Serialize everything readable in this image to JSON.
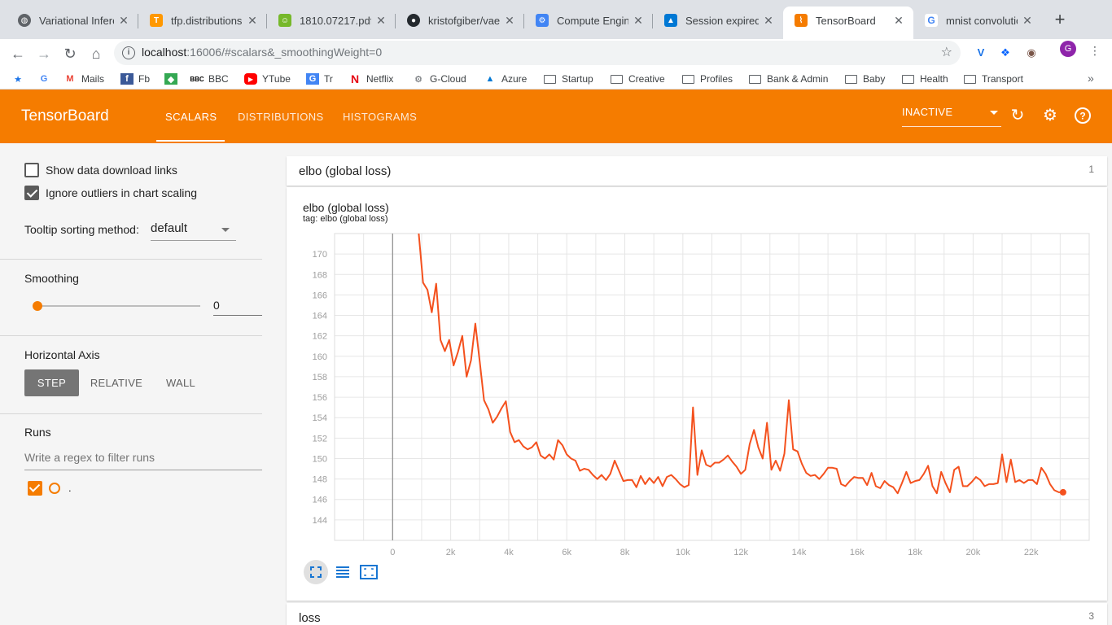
{
  "browser": {
    "tabs": [
      {
        "label": "Variational Infere",
        "icon_color": "#5f6368",
        "icon": "globe-icon"
      },
      {
        "label": "tfp.distributions.",
        "icon_color": "#ff9800",
        "icon": "tensorflow-icon"
      },
      {
        "label": "1810.07217.pdf",
        "icon_color": "#76b82a",
        "icon": "pdf-icon"
      },
      {
        "label": "kristofgiber/vae-",
        "icon_color": "#24292e",
        "icon": "github-icon"
      },
      {
        "label": "Compute Engine",
        "icon_color": "#4285f4",
        "icon": "gcp-icon"
      },
      {
        "label": "Session expired",
        "icon_color": "#0078d4",
        "icon": "azure-icon"
      },
      {
        "label": "TensorBoard",
        "icon_color": "#f57c00",
        "icon": "tensorboard-icon"
      },
      {
        "label": "mnist convolutio",
        "icon_color": "#4285f4",
        "icon": "google-icon"
      }
    ],
    "url_host": "localhost",
    "url_path": ":16006/#scalars&_smoothingWeight=0",
    "profile_initial": "G",
    "bookmarks": [
      {
        "label": "",
        "icon": "star-icon"
      },
      {
        "label": "",
        "icon": "google-icon"
      },
      {
        "label": "Mails",
        "icon": "gmail-icon"
      },
      {
        "label": "Fb",
        "icon": "facebook-icon"
      },
      {
        "label": "",
        "icon": "maps-icon"
      },
      {
        "label": "BBC",
        "icon": "bbc-icon"
      },
      {
        "label": "YTube",
        "icon": "youtube-icon"
      },
      {
        "label": "Tr",
        "icon": "translate-icon"
      },
      {
        "label": "Netflix",
        "icon": "netflix-icon"
      },
      {
        "label": "G-Cloud",
        "icon": "gcloud-icon"
      },
      {
        "label": "Azure",
        "icon": "azure-icon"
      },
      {
        "label": "Startup",
        "icon": "folder-icon"
      },
      {
        "label": "Creative",
        "icon": "folder-icon"
      },
      {
        "label": "Profiles",
        "icon": "folder-icon"
      },
      {
        "label": "Bank & Admin",
        "icon": "folder-icon"
      },
      {
        "label": "Baby",
        "icon": "folder-icon"
      },
      {
        "label": "Health",
        "icon": "folder-icon"
      },
      {
        "label": "Transport",
        "icon": "folder-icon"
      }
    ]
  },
  "tensorboard": {
    "brand": "TensorBoard",
    "tabs": [
      "SCALARS",
      "DISTRIBUTIONS",
      "HISTOGRAMS"
    ],
    "active_tab": "SCALARS",
    "status": "INACTIVE",
    "accent": "#f57c00"
  },
  "sidebar": {
    "show_download": "Show data download links",
    "ignore_outliers": "Ignore outliers in chart scaling",
    "tooltip_label": "Tooltip sorting method:",
    "tooltip_value": "default",
    "smoothing_label": "Smoothing",
    "smoothing_value": "0",
    "smoothing_fraction": 0,
    "axis_label": "Horizontal Axis",
    "axis_options": [
      "STEP",
      "RELATIVE",
      "WALL"
    ],
    "axis_selected": "STEP",
    "runs_label": "Runs",
    "runs_placeholder": "Write a regex to filter runs",
    "run_name": "."
  },
  "main": {
    "group1_title": "elbo (global loss)",
    "group1_count": "1",
    "chart_title": "elbo (global loss)",
    "chart_tag": "tag: elbo (global loss)",
    "group2_title": "loss",
    "group2_count": "3"
  },
  "chart_data": {
    "type": "line",
    "title": "elbo (global loss)",
    "xlabel": "",
    "ylabel": "",
    "xlim": [
      -2000,
      24000
    ],
    "ylim": [
      142,
      172
    ],
    "x_ticks": [
      0,
      2000,
      4000,
      6000,
      8000,
      10000,
      12000,
      14000,
      16000,
      18000,
      20000,
      22000
    ],
    "x_tick_labels": [
      "0",
      "2k",
      "4k",
      "6k",
      "8k",
      "10k",
      "12k",
      "14k",
      "16k",
      "18k",
      "20k",
      "22k"
    ],
    "y_ticks": [
      144,
      146,
      148,
      150,
      152,
      154,
      156,
      158,
      160,
      162,
      164,
      166,
      168,
      170
    ],
    "grid": true,
    "color": "#f4511e",
    "series": [
      {
        "x": [
          900,
          1050,
          1200,
          1350,
          1500,
          1650,
          1800,
          1950,
          2100,
          2250,
          2400,
          2550,
          2700,
          2850,
          3000,
          3150,
          3300,
          3450,
          3600,
          3750,
          3900,
          4050,
          4200,
          4350,
          4500,
          4650,
          4800,
          4950,
          5100,
          5250,
          5400,
          5550,
          5700,
          5850,
          6000,
          6150,
          6300,
          6450,
          6600,
          6750,
          6900,
          7050,
          7200,
          7350,
          7500,
          7650,
          7800,
          7950,
          8100,
          8250,
          8400,
          8550,
          8700,
          8850,
          9000,
          9150,
          9300,
          9450,
          9600,
          9750,
          9900,
          10050,
          10200,
          10350,
          10500,
          10650,
          10800,
          10950,
          11100,
          11250,
          11400,
          11550,
          11700,
          11850,
          12000,
          12150,
          12300,
          12450,
          12600,
          12750,
          12900,
          13050,
          13200,
          13350,
          13500,
          13650,
          13800,
          13950,
          14100,
          14250,
          14400,
          14550,
          14700,
          14850,
          15000,
          15150,
          15300,
          15450,
          15600,
          15750,
          15900,
          16050,
          16200,
          16350,
          16500,
          16650,
          16800,
          16950,
          17100,
          17250,
          17400,
          17550,
          17700,
          17850,
          18000,
          18150,
          18300,
          18450,
          18600,
          18750,
          18900,
          19050,
          19200,
          19350,
          19500,
          19650,
          19800,
          19950,
          20100,
          20250,
          20400,
          20550,
          20700,
          20850,
          21000,
          21150,
          21300,
          21450,
          21600,
          21750,
          21900,
          22050,
          22200,
          22350,
          22500,
          22650,
          22800,
          22950,
          23100
        ],
        "y": [
          172,
          167.2,
          166.5,
          164.3,
          167.1,
          161.6,
          160.5,
          161.6,
          159.1,
          160.4,
          162,
          158,
          159.6,
          163.2,
          159.5,
          155.7,
          154.8,
          153.5,
          154.1,
          154.9,
          155.6,
          152.6,
          151.6,
          151.8,
          151.2,
          150.9,
          151.1,
          151.6,
          150.3,
          150,
          150.4,
          149.9,
          151.8,
          151.3,
          150.4,
          150,
          149.8,
          148.8,
          149,
          148.9,
          148.4,
          148,
          148.4,
          147.9,
          148.5,
          149.8,
          148.8,
          147.8,
          147.9,
          147.9,
          147.2,
          148.3,
          147.5,
          148.1,
          147.6,
          148.2,
          147.3,
          148.2,
          148.4,
          148,
          147.5,
          147.2,
          147.4,
          155,
          148.4,
          150.8,
          149.4,
          149.2,
          149.6,
          149.6,
          149.9,
          150.3,
          149.7,
          149.2,
          148.5,
          148.9,
          151.4,
          152.8,
          151.1,
          150,
          153.5,
          148.9,
          149.8,
          148.8,
          150.5,
          155.7,
          150.9,
          150.7,
          149.5,
          148.6,
          148.3,
          148.4,
          148,
          148.5,
          149.1,
          149.1,
          149,
          147.5,
          147.3,
          147.8,
          148.2,
          148.1,
          148.1,
          147.4,
          148.6,
          147.3,
          147.1,
          147.8,
          147.4,
          147.2,
          146.6,
          147.6,
          148.7,
          147.6,
          147.8,
          147.9,
          148.5,
          149.3,
          147.3,
          146.6,
          148.7,
          147.6,
          146.7,
          148.9,
          149.2,
          147.3,
          147.3,
          147.7,
          148.2,
          147.9,
          147.3,
          147.5,
          147.5,
          147.6,
          150.4,
          147.7,
          149.9,
          147.7,
          147.9,
          147.6,
          147.9,
          147.9,
          147.5,
          149.1,
          148.5,
          147.5,
          146.9,
          146.7,
          146.7
        ]
      }
    ]
  }
}
